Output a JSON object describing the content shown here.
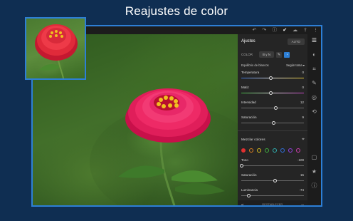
{
  "headline": "Reajustes de color",
  "toolbar": {
    "icons": [
      "undo-icon",
      "redo-icon",
      "info-icon",
      "check-icon",
      "cloud-icon",
      "share-icon",
      "more-icon"
    ]
  },
  "panel": {
    "title": "Ajustes",
    "auto_label": "AUTO",
    "color_label": "COLOR",
    "bw_label": "B y N",
    "white_balance_label": "Equilibrio de blancos",
    "white_balance_value": "Según toma",
    "sliders": [
      {
        "label": "Temperatura",
        "value": "0",
        "position": 0.5
      },
      {
        "label": "Matiz",
        "value": "0",
        "position": 0.5
      },
      {
        "label": "Intensidad",
        "value": "12",
        "position": 0.58
      },
      {
        "label": "Saturación",
        "value": "9",
        "position": 0.55
      }
    ],
    "mixer_title": "Mezclar colores",
    "mixer_colors": [
      "#e03030",
      "#e08020",
      "#d8c020",
      "#40b040",
      "#30b0b0",
      "#3070e0",
      "#9040e0",
      "#d040b0"
    ],
    "mixer_selected": 0,
    "hsl_sliders": [
      {
        "label": "Tono",
        "value": "-100",
        "position": 0.0
      },
      {
        "label": "Saturación",
        "value": "15",
        "position": 0.57
      },
      {
        "label": "Luminancia",
        "value": "-74",
        "position": 0.13
      }
    ],
    "bottom_label": "RESTABLECER"
  }
}
